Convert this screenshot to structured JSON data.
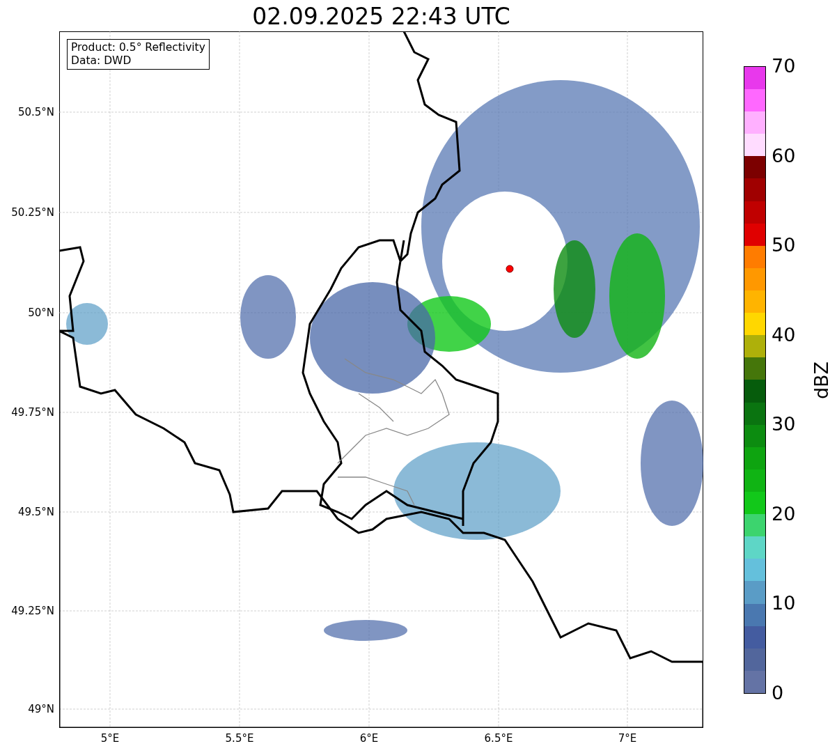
{
  "title": "02.09.2025 22:43 UTC",
  "info_box": {
    "lines": [
      "Product: 0.5° Reflectivity",
      "Data: DWD"
    ]
  },
  "y_ticks": [
    "50.5°N",
    "50.25°N",
    "50°N",
    "49.75°N",
    "49.5°N",
    "49.25°N",
    "49°N"
  ],
  "x_ticks": [
    "5°E",
    "5.5°E",
    "6°E",
    "6.5°E",
    "7°E"
  ],
  "colorbar": {
    "label": "dBZ",
    "ticks": [
      "70",
      "60",
      "50",
      "40",
      "30",
      "20",
      "10",
      "0"
    ],
    "segments": [
      {
        "color": "#6473a5"
      },
      {
        "color": "#52669c"
      },
      {
        "color": "#445ca0"
      },
      {
        "color": "#4a78b0"
      },
      {
        "color": "#5a9cc6"
      },
      {
        "color": "#64c0dc"
      },
      {
        "color": "#5ed6c6"
      },
      {
        "color": "#3cd46e"
      },
      {
        "color": "#12c81a"
      },
      {
        "color": "#10b414"
      },
      {
        "color": "#0ea410"
      },
      {
        "color": "#0c8c10"
      },
      {
        "color": "#0a7410"
      },
      {
        "color": "#065c0c"
      },
      {
        "color": "#45760a"
      },
      {
        "color": "#aeb00a"
      },
      {
        "color": "#ffd700"
      },
      {
        "color": "#ffb400"
      },
      {
        "color": "#ff9800"
      },
      {
        "color": "#ff7c00"
      },
      {
        "color": "#e00000"
      },
      {
        "color": "#c00000"
      },
      {
        "color": "#a00000"
      },
      {
        "color": "#7c0000"
      },
      {
        "color": "#ffdcff"
      },
      {
        "color": "#ffb0ff"
      },
      {
        "color": "#ff68ff"
      },
      {
        "color": "#e838ec"
      }
    ]
  }
}
